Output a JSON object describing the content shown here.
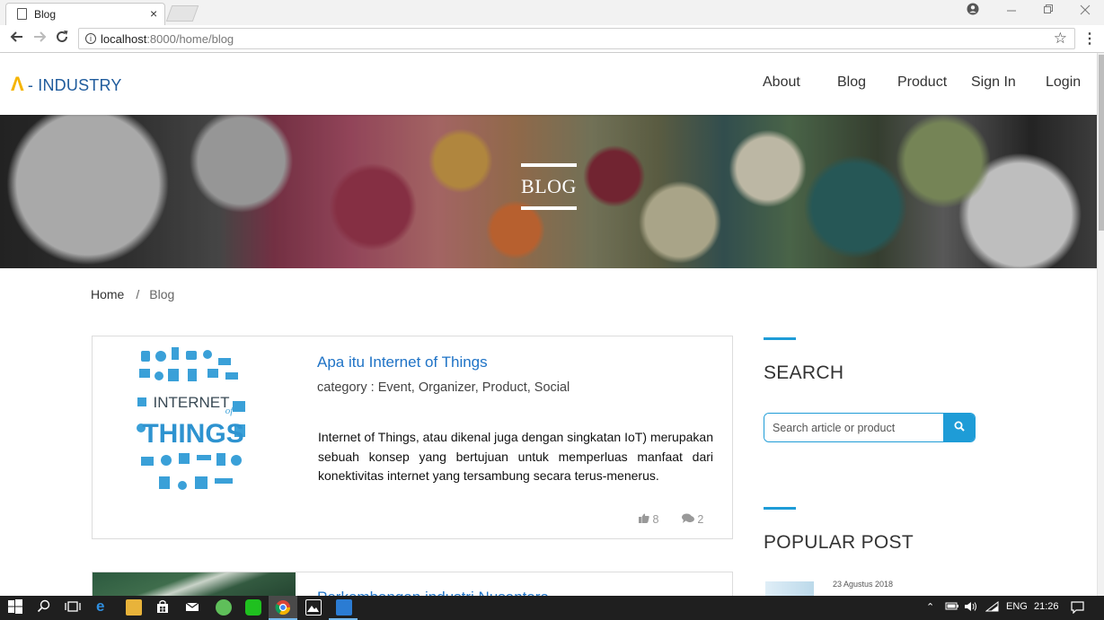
{
  "browser": {
    "tab_title": "Blog",
    "url_host": "localhost",
    "url_rest": ":8000/home/blog",
    "close_glyph": "×"
  },
  "site": {
    "logo_mark": "Λ",
    "logo_text": "- INDUSTRY",
    "nav": [
      "About",
      "Blog",
      "Product",
      "Sign In",
      "Login"
    ]
  },
  "hero": {
    "title": "BLOG"
  },
  "breadcrumb": {
    "home": "Home",
    "separator": "/",
    "current": "Blog"
  },
  "posts": [
    {
      "title": "Apa itu Internet of Things",
      "category": "category : Event, Organizer, Product, Social",
      "excerpt": "Internet of Things, atau dikenal juga dengan singkatan IoT) merupakan sebuah konsep yang bertujuan untuk memperluas manfaat dari konektivitas internet yang tersambung secara terus-menerus.",
      "likes": "8",
      "comments": "2",
      "thumb_text": [
        "INTERNET",
        "of",
        "THINGS"
      ]
    },
    {
      "title": "Perkembangan industri Nusantara"
    }
  ],
  "sidebar": {
    "search_heading": "SEARCH",
    "search_placeholder": "Search article or product",
    "popular_heading": "POPULAR POST",
    "popular_date": "23 Agustus 2018"
  },
  "taskbar": {
    "lang": "ENG",
    "time": "21:26"
  },
  "colors": {
    "accent": "#1e9cd7",
    "link": "#1f73c6",
    "logo": "#1f5b9c",
    "logo_mark": "#f5b400"
  }
}
